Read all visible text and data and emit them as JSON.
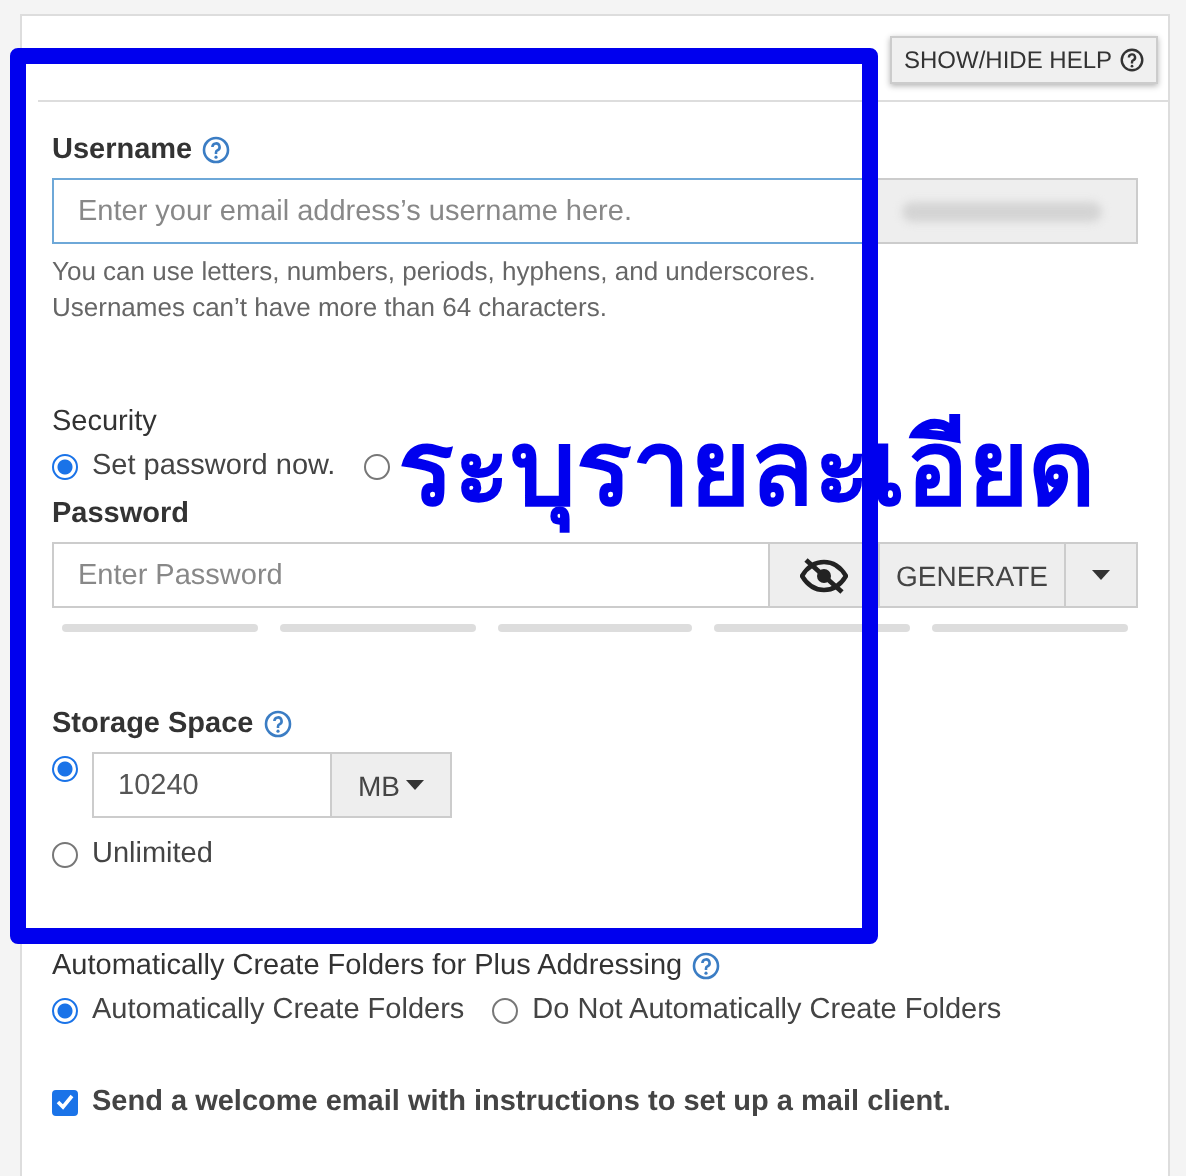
{
  "help_button": {
    "label": "SHOW/HIDE HELP"
  },
  "username": {
    "label": "Username",
    "placeholder": "Enter your email address’s username here.",
    "hint": "You can use letters, numbers, periods, hyphens, and underscores. Usernames can’t have more than 64 characters."
  },
  "security": {
    "label": "Security",
    "options": [
      {
        "label": "Set password now.",
        "selected": true
      },
      {
        "selected": false
      }
    ]
  },
  "password": {
    "label": "Password",
    "placeholder": "Enter Password",
    "generate": "GENERATE",
    "strength": [
      {
        "on": false
      },
      {
        "on": false
      },
      {
        "on": false
      },
      {
        "on": false
      },
      {
        "on": false
      }
    ]
  },
  "storage": {
    "label": "Storage Space",
    "options": [
      {
        "kind": "quota",
        "value": "10240",
        "unit": "MB",
        "selected": true
      },
      {
        "kind": "text",
        "label": "Unlimited",
        "selected": false
      }
    ]
  },
  "plus_addressing": {
    "label": "Automatically Create Folders for Plus Addressing",
    "options": [
      {
        "label": "Automatically Create Folders",
        "selected": true
      },
      {
        "label": "Do Not Automatically Create Folders",
        "selected": false
      }
    ]
  },
  "welcome": {
    "label": "Send a welcome email with instructions to set up a mail client.",
    "checked": true
  },
  "annotation": {
    "text": "ระบุรายละเอียด"
  }
}
